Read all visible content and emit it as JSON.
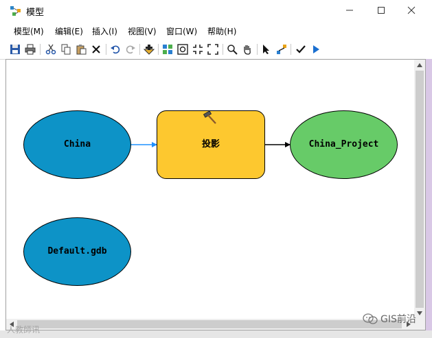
{
  "window": {
    "title": "模型",
    "icon": "model-icon",
    "controls": {
      "minimize": "minimize-icon",
      "maximize": "maximize-icon",
      "close": "close-icon"
    }
  },
  "menu": [
    {
      "label": "模型(M)"
    },
    {
      "label": "编辑(E)"
    },
    {
      "label": "插入(I)"
    },
    {
      "label": "视图(V)"
    },
    {
      "label": "窗口(W)"
    },
    {
      "label": "帮助(H)"
    }
  ],
  "toolbar": [
    {
      "icon": "save-icon"
    },
    {
      "icon": "print-icon"
    },
    {
      "icon": "cut-icon"
    },
    {
      "icon": "copy-icon"
    },
    {
      "icon": "paste-icon"
    },
    {
      "icon": "delete-icon"
    },
    {
      "icon": "undo-icon"
    },
    {
      "icon": "redo-icon"
    },
    {
      "icon": "add-data-icon"
    },
    {
      "icon": "auto-layout-icon"
    },
    {
      "icon": "full-extent-icon"
    },
    {
      "icon": "zoom-in-fixed-icon"
    },
    {
      "icon": "zoom-out-fixed-icon"
    },
    {
      "icon": "zoom-icon"
    },
    {
      "icon": "pan-icon"
    },
    {
      "icon": "select-icon"
    },
    {
      "icon": "connect-icon"
    },
    {
      "icon": "validate-icon"
    },
    {
      "icon": "run-icon"
    }
  ],
  "diagram": {
    "nodes": [
      {
        "id": "china",
        "label": "China",
        "shape": "ellipse",
        "color": "#0d93c7",
        "type": "data"
      },
      {
        "id": "project",
        "label": "投影",
        "shape": "rect",
        "color": "#fdc82f",
        "type": "tool",
        "icon": "hammer-icon"
      },
      {
        "id": "china_project",
        "label": "China_Project",
        "shape": "ellipse",
        "color": "#67cb68",
        "type": "output"
      },
      {
        "id": "default_gdb",
        "label": "Default.gdb",
        "shape": "ellipse",
        "color": "#0d93c7",
        "type": "data"
      }
    ],
    "edges": [
      {
        "from": "china",
        "to": "project",
        "color": "#1e90ff"
      },
      {
        "from": "project",
        "to": "china_project",
        "color": "#000000"
      }
    ]
  },
  "watermark": {
    "left": "人教師讯",
    "right": "GIS前沿"
  }
}
